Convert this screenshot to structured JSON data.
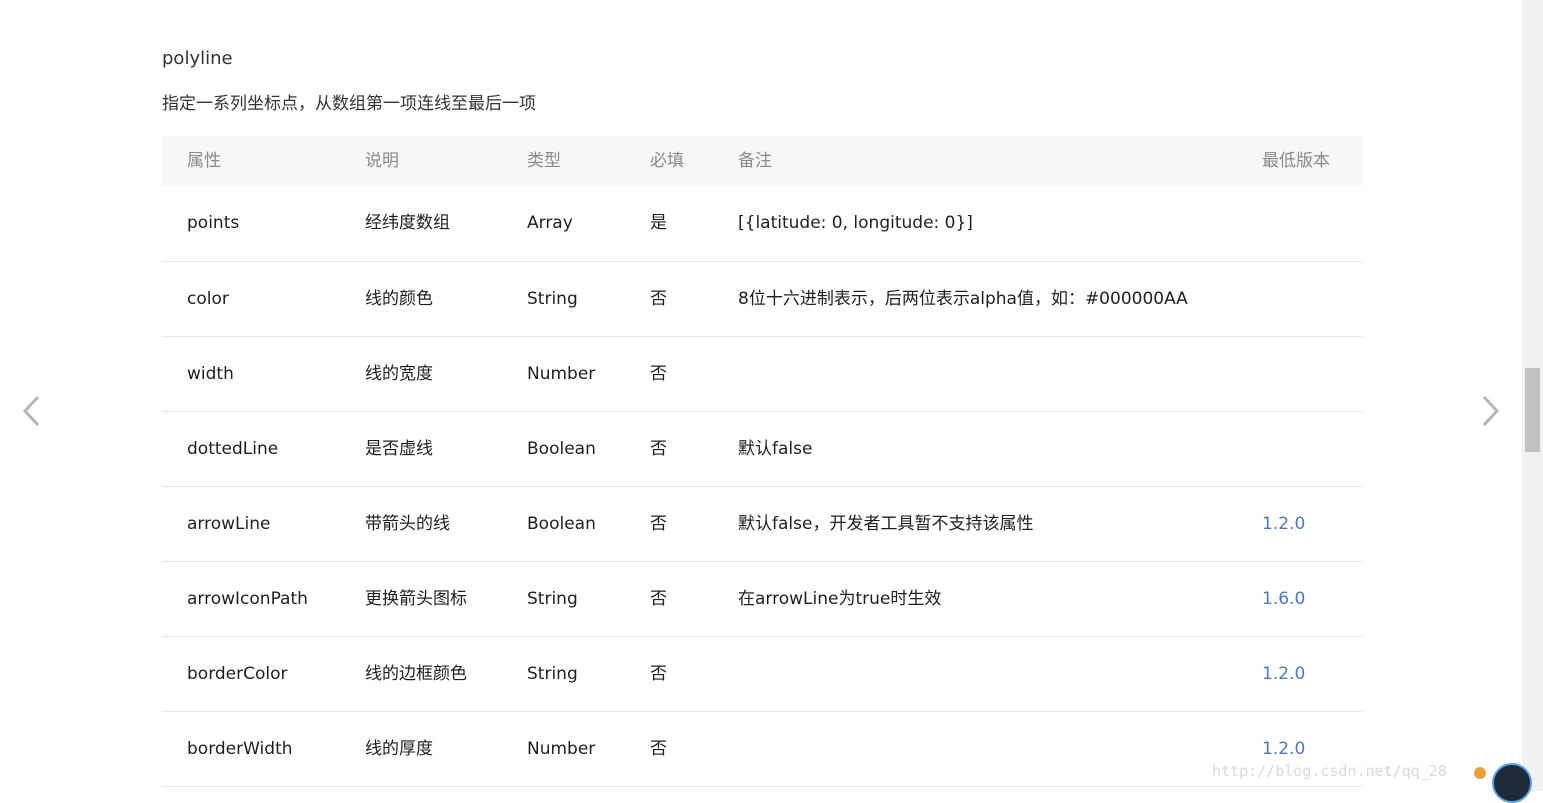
{
  "section": {
    "title": "polyline",
    "description": "指定一系列坐标点，从数组第一项连线至最后一项"
  },
  "table": {
    "headers": [
      "属性",
      "说明",
      "类型",
      "必填",
      "备注",
      "最低版本"
    ],
    "rows": [
      {
        "attr": "points",
        "desc": "经纬度数组",
        "type": "Array",
        "required": "是",
        "note": "[{latitude: 0, longitude: 0}]",
        "version": ""
      },
      {
        "attr": "color",
        "desc": "线的颜色",
        "type": "String",
        "required": "否",
        "note": "8位十六进制表示，后两位表示alpha值，如：#000000AA",
        "version": ""
      },
      {
        "attr": "width",
        "desc": "线的宽度",
        "type": "Number",
        "required": "否",
        "note": "",
        "version": ""
      },
      {
        "attr": "dottedLine",
        "desc": "是否虚线",
        "type": "Boolean",
        "required": "否",
        "note": "默认false",
        "version": ""
      },
      {
        "attr": "arrowLine",
        "desc": "带箭头的线",
        "type": "Boolean",
        "required": "否",
        "note": "默认false，开发者工具暂不支持该属性",
        "version": "1.2.0"
      },
      {
        "attr": "arrowIconPath",
        "desc": "更换箭头图标",
        "type": "String",
        "required": "否",
        "note": "在arrowLine为true时生效",
        "version": "1.6.0"
      },
      {
        "attr": "borderColor",
        "desc": "线的边框颜色",
        "type": "String",
        "required": "否",
        "note": "",
        "version": "1.2.0"
      },
      {
        "attr": "borderWidth",
        "desc": "线的厚度",
        "type": "Number",
        "required": "否",
        "note": "",
        "version": "1.2.0"
      }
    ]
  },
  "nav": {
    "prev_icon": "chevron-left-icon",
    "next_icon": "chevron-right-icon"
  },
  "watermark": "http://blog.csdn.net/qq_28",
  "colors": {
    "version_link": "#4f78b8",
    "header_bg": "#f6f7f8",
    "header_text": "#8a8a8a",
    "row_border": "#e7e7e7"
  }
}
